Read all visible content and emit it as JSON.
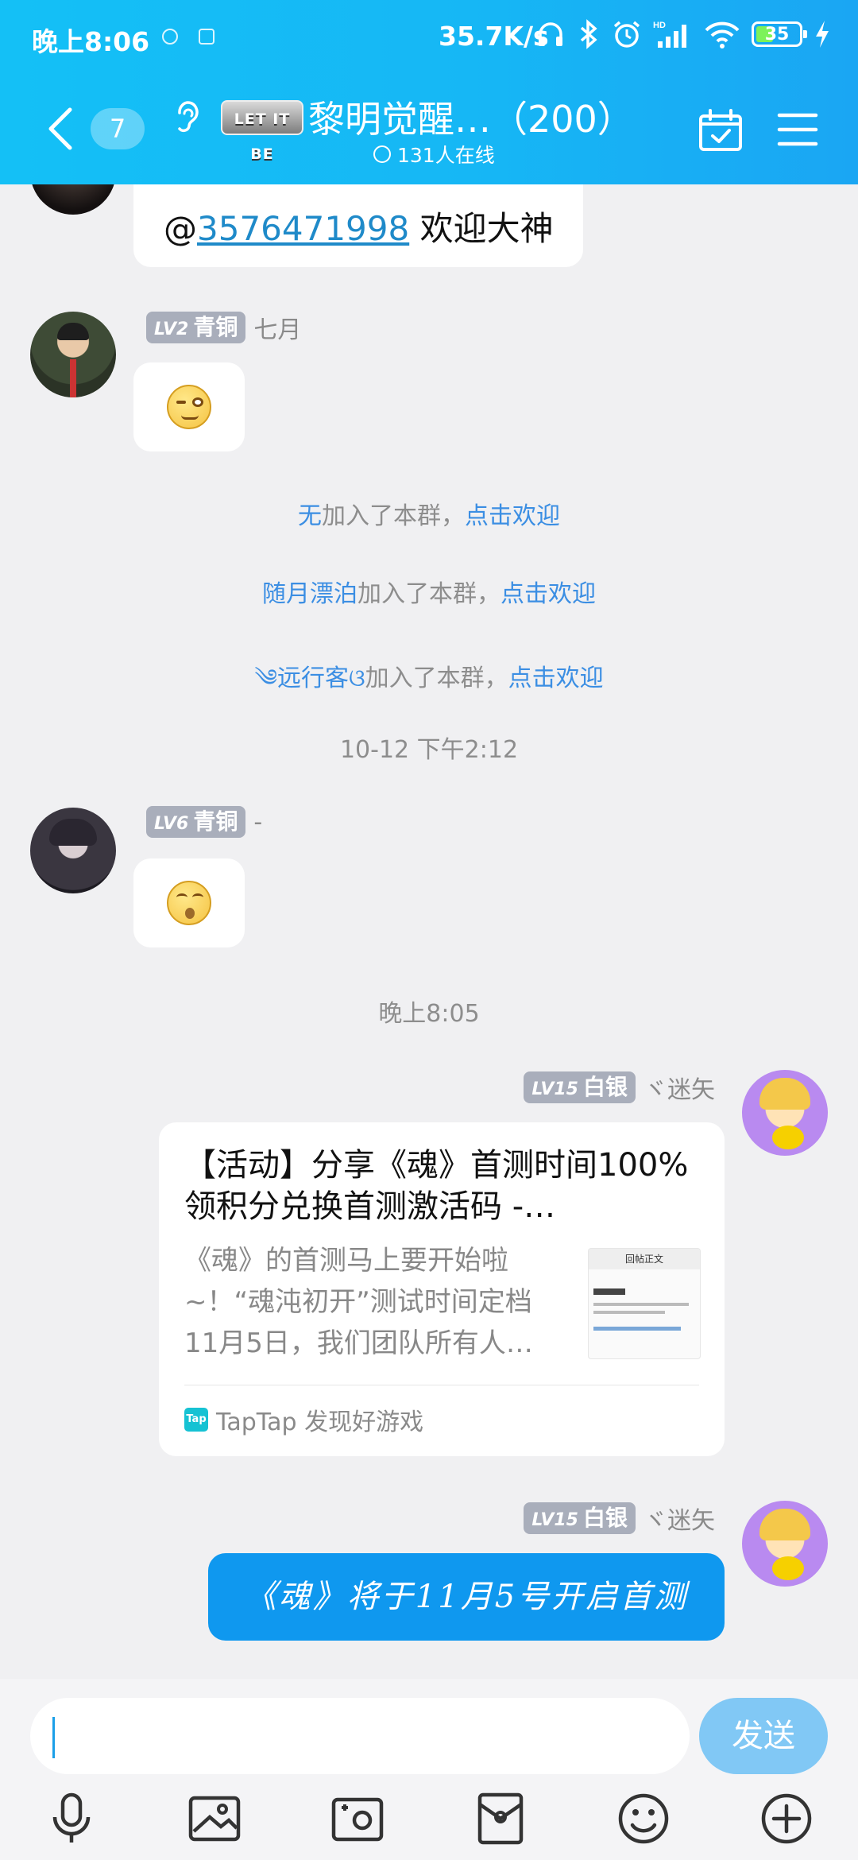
{
  "status_bar": {
    "time": "晚上8:06",
    "speed": "35.7K/s",
    "battery": "35"
  },
  "header": {
    "unread_count": "7",
    "badge_text": "LET IT BE",
    "group_name": "黎明觉醒…（200）",
    "online": "131人在线"
  },
  "messages": [
    {
      "text_prefix": "@",
      "mention": "3576471998",
      "text_suffix": " 欢迎大神"
    },
    {
      "level": "LV2",
      "rank": "青铜",
      "sender": "七月"
    },
    {
      "level": "LV6",
      "rank": "青铜",
      "sender": "-"
    },
    {
      "level": "LV15",
      "rank": "白银",
      "sender": "ヾ迷矢"
    },
    {
      "level": "LV15",
      "rank": "白银",
      "sender": "ヾ迷矢",
      "text": "《魂》将于11月5号开启首测"
    }
  ],
  "system": [
    {
      "name": "无",
      "joined": "加入了本群，",
      "action": "点击欢迎"
    },
    {
      "name": "随月漂泊",
      "joined": "加入了本群，",
      "action": "点击欢迎"
    },
    {
      "name": "༄远行客ଓ",
      "joined": "加入了本群，",
      "action": "点击欢迎"
    }
  ],
  "timestamps": {
    "t1": "10-12 下午2:12",
    "t2": "晚上8:05"
  },
  "link_card": {
    "title": "【活动】分享《魂》首测时间100%领积分兑换首测激活码 -…",
    "description": "《魂》的首测马上要开始啦~！“魂沌初开”测试时间定档11月5日，我们团队所有人…",
    "thumb_title": "回帖正文",
    "source_logo": "Tap",
    "source": "TapTap 发现好游戏"
  },
  "input": {
    "send_label": "发送"
  },
  "colors": {
    "header": "#14c0f6",
    "accent": "#0f98ef",
    "link": "#3b8ee3",
    "level_badge": "#a9aebb"
  },
  "toolbar": [
    "mic-icon",
    "image-icon",
    "camera-icon",
    "red-packet-icon",
    "emoji-icon",
    "plus-icon"
  ]
}
